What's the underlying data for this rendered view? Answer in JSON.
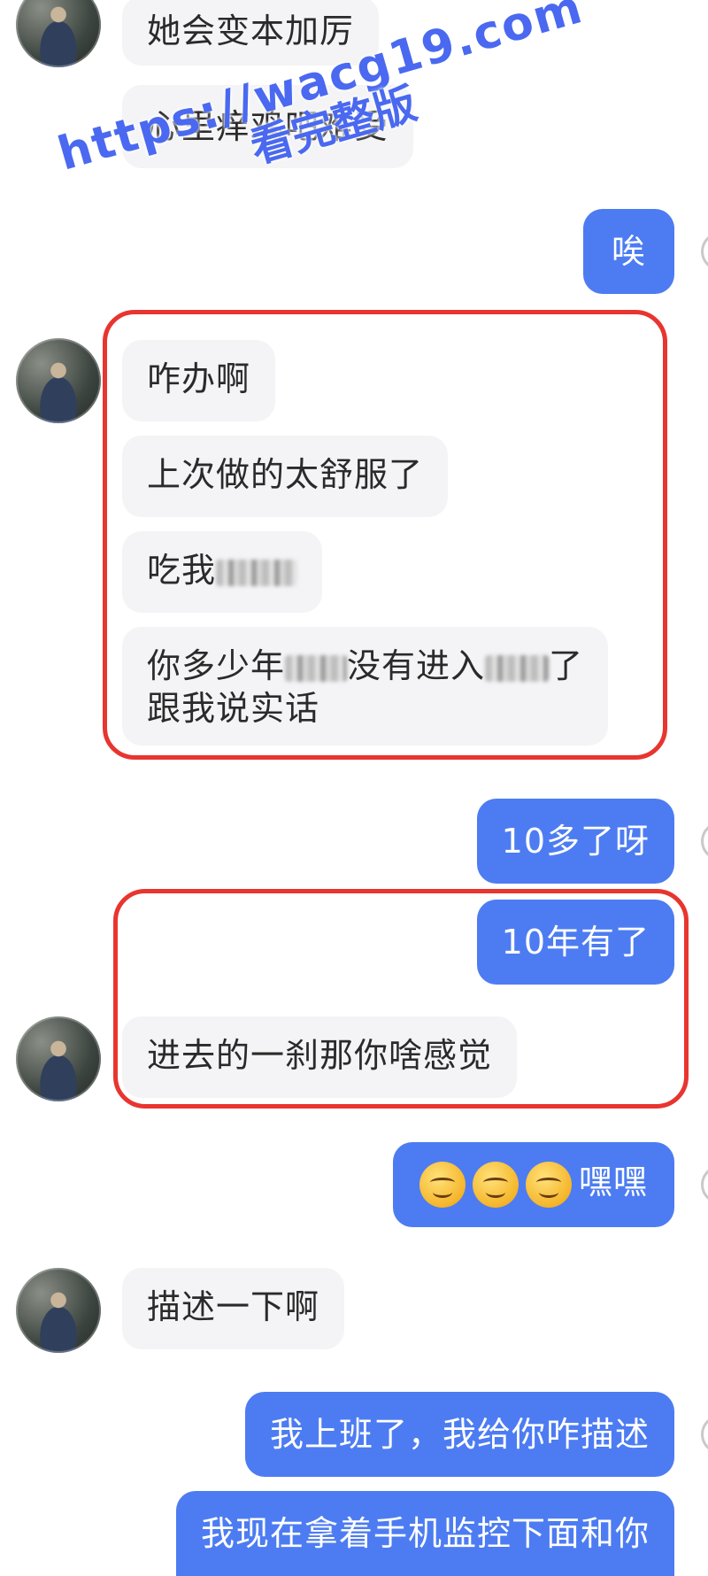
{
  "watermark": {
    "url": "https://wacg19.com",
    "label": "看完整版"
  },
  "messages": {
    "m1": "她会变本加厉",
    "m2": "心里痒鸡吧难受",
    "m3": "唉",
    "m4": "咋办啊",
    "m5": "上次做的太舒服了",
    "m6_pre": "吃我",
    "m7_part1": "你多少年",
    "m7_part2": "没有进入",
    "m7_part3": "了",
    "m7_line2": "跟我说实话",
    "m8": "10多了呀",
    "m9": "10年有了",
    "m10": "进去的一刹那你啥感觉",
    "m11_text": "嘿嘿",
    "m11_emojis": [
      "smiling-face-emoji",
      "smiling-face-emoji",
      "smiling-face-emoji"
    ],
    "m12": "描述一下啊",
    "m13": "我上班了，我给你咋描述",
    "m14": "我现在拿着手机监控下面和你"
  },
  "colors": {
    "outgoing": "#4d7cf2",
    "incoming": "#f4f4f6",
    "highlight": "#e8352f",
    "watermark": "#4a69f0"
  }
}
